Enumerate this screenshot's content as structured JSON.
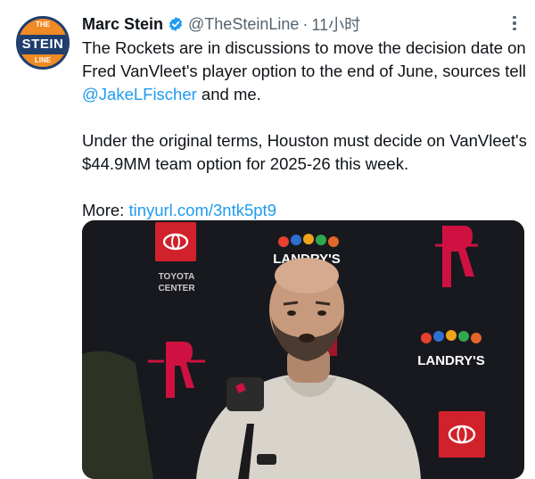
{
  "tweet": {
    "author_name": "Marc Stein",
    "handle": "@TheSteinLine",
    "separator": "·",
    "time": "11小时",
    "paragraphs": {
      "p1_before": "The Rockets are in discussions to move the decision date on Fred VanVleet's player option to the end of June, sources tell ",
      "p1_mention": "@JakeLFischer",
      "p1_after": " and me.",
      "p2": "Under the original terms, Houston must decide on VanVleet's $44.9MM team option for 2025-26 this week.",
      "p3_label": "More: ",
      "p3_link": "tinyurl.com/3ntk5pt9"
    },
    "avatar": {
      "top": "THE",
      "middle": "STEIN",
      "bottom": "LINE"
    },
    "media_logos": {
      "arena_line1": "TOYOTA",
      "arena_line2": "CENTER",
      "sponsor": "LANDRY'S"
    }
  },
  "colors": {
    "accent_link": "#1d9bf0",
    "verified": "#1d9bf0",
    "rockets_red": "#ce1141",
    "avatar_orange": "#f08a24",
    "avatar_navy": "#1f3e6e"
  },
  "icons": {
    "verified": "verified-badge-icon",
    "more": "more-options-icon"
  }
}
